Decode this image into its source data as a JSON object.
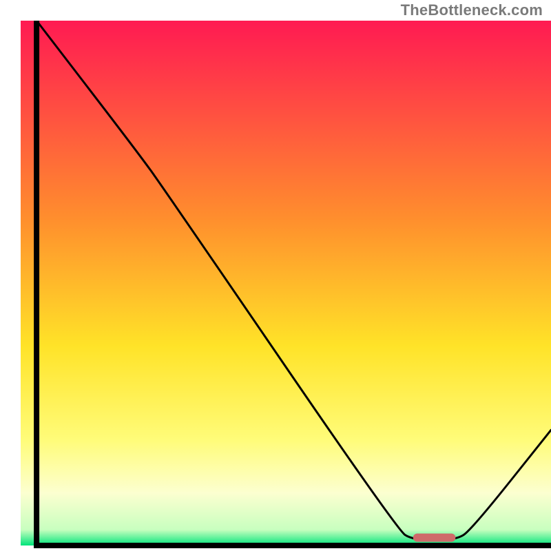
{
  "attribution": "TheBottleneck.com",
  "chart_data": {
    "type": "line",
    "title": "",
    "xlabel": "",
    "ylabel": "",
    "xlim": [
      0,
      100
    ],
    "ylim": [
      0,
      100
    ],
    "background_gradient": {
      "stops": [
        {
          "at": 0,
          "color": "#ff1a52"
        },
        {
          "at": 38,
          "color": "#ff8f2d"
        },
        {
          "at": 62,
          "color": "#ffe328"
        },
        {
          "at": 80,
          "color": "#fffc7a"
        },
        {
          "at": 90,
          "color": "#fcffd0"
        },
        {
          "at": 97,
          "color": "#c8ffbf"
        },
        {
          "at": 100,
          "color": "#00e47a"
        }
      ]
    },
    "curve": [
      {
        "x": 3,
        "y": 100
      },
      {
        "x": 22,
        "y": 75
      },
      {
        "x": 27,
        "y": 68
      },
      {
        "x": 71,
        "y": 3
      },
      {
        "x": 74,
        "y": 1
      },
      {
        "x": 82,
        "y": 1
      },
      {
        "x": 85,
        "y": 3
      },
      {
        "x": 100,
        "y": 22
      }
    ],
    "highlight_bar": {
      "x_start": 74,
      "x_end": 82,
      "y": 1.5,
      "color": "#cf6a6a"
    },
    "axes": {
      "left": {
        "x": 3,
        "y0": 0,
        "y1": 100
      },
      "bottom": {
        "y": 0,
        "x0": 3,
        "x1": 100
      }
    }
  }
}
